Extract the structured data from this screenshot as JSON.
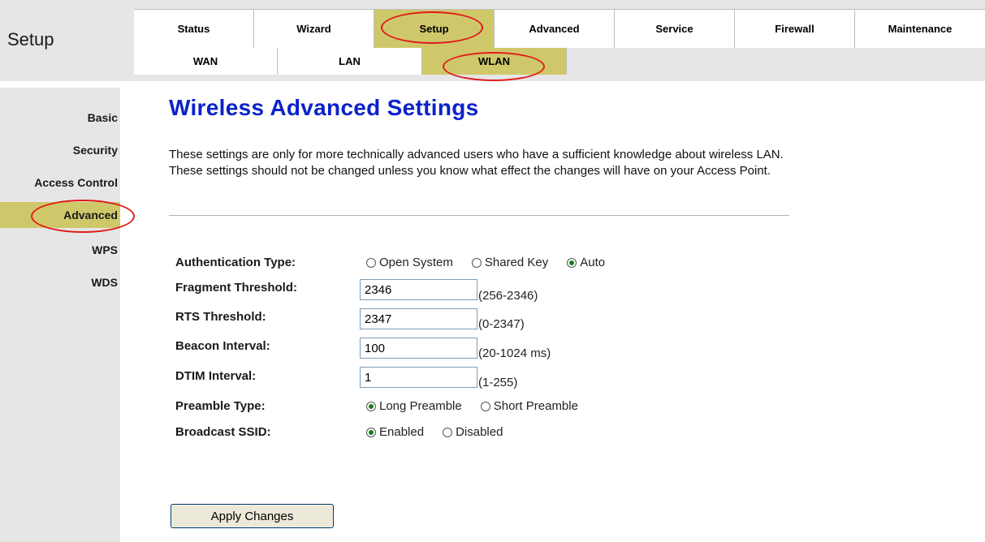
{
  "section_title": "Setup",
  "tabs": [
    {
      "label": "Status",
      "active": false
    },
    {
      "label": "Wizard",
      "active": false
    },
    {
      "label": "Setup",
      "active": true
    },
    {
      "label": "Advanced",
      "active": false
    },
    {
      "label": "Service",
      "active": false
    },
    {
      "label": "Firewall",
      "active": false
    },
    {
      "label": "Maintenance",
      "active": false
    }
  ],
  "subtabs": [
    {
      "label": "WAN",
      "active": false
    },
    {
      "label": "LAN",
      "active": false
    },
    {
      "label": "WLAN",
      "active": true
    }
  ],
  "sidebar": {
    "items": [
      {
        "label": "Basic",
        "active": false
      },
      {
        "label": "Security",
        "active": false
      },
      {
        "label": "Access Control",
        "active": false
      },
      {
        "label": "Advanced",
        "active": true
      },
      {
        "label": "WPS",
        "active": false
      },
      {
        "label": "WDS",
        "active": false
      }
    ]
  },
  "page": {
    "title": "Wireless Advanced Settings",
    "intro": "These settings are only for more technically advanced users who have a sufficient knowledge about wireless LAN. These settings should not be changed unless you know what effect the changes will have on your Access Point."
  },
  "form": {
    "auth_type": {
      "label": "Authentication Type:",
      "options": [
        "Open System",
        "Shared Key",
        "Auto"
      ],
      "selected": "Auto"
    },
    "fragment": {
      "label": "Fragment Threshold:",
      "value": "2346",
      "range": "(256-2346)"
    },
    "rts": {
      "label": "RTS Threshold:",
      "value": "2347",
      "range": "(0-2347)"
    },
    "beacon": {
      "label": "Beacon Interval:",
      "value": "100",
      "range": "(20-1024 ms)"
    },
    "dtim": {
      "label": "DTIM Interval:",
      "value": "1",
      "range": "(1-255)"
    },
    "preamble": {
      "label": "Preamble Type:",
      "options": [
        "Long Preamble",
        "Short Preamble"
      ],
      "selected": "Long Preamble"
    },
    "broadcast": {
      "label": "Broadcast SSID:",
      "options": [
        "Enabled",
        "Disabled"
      ],
      "selected": "Enabled"
    },
    "apply_label": "Apply Changes"
  },
  "colors": {
    "accent": "#cfc86a",
    "title": "#0b22c8",
    "highlight_circle": "#e11a1a",
    "panel": "#e6e6e6"
  }
}
